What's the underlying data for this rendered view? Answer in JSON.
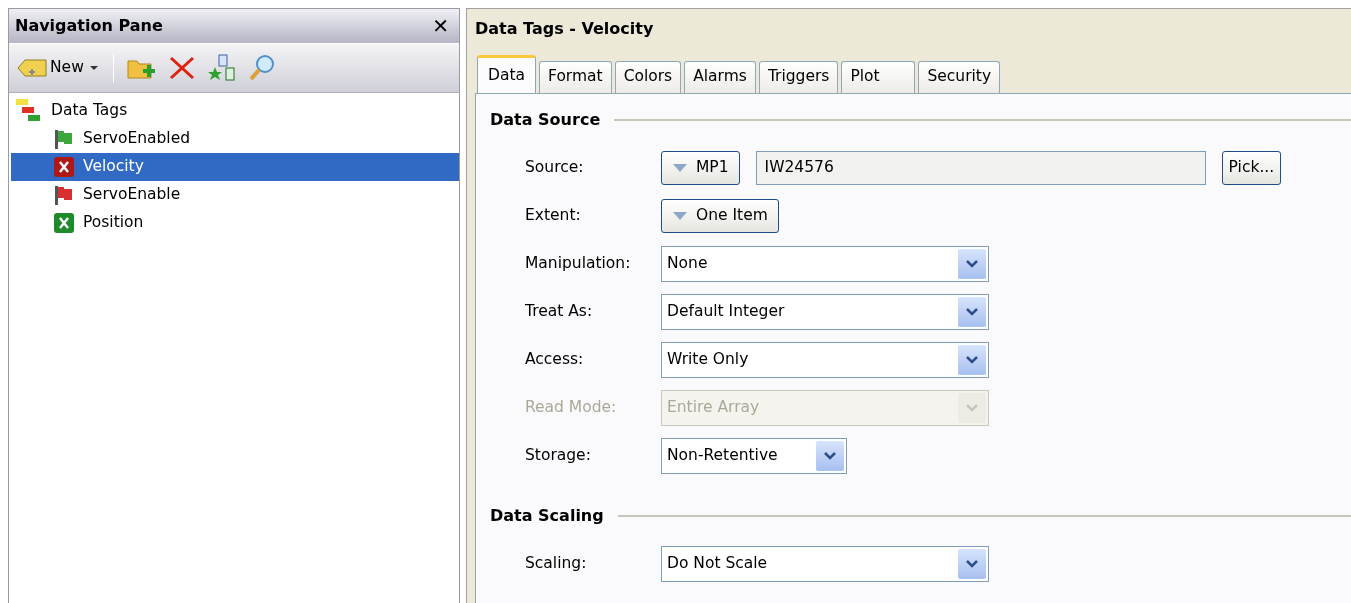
{
  "navigation_pane": {
    "title": "Navigation Pane",
    "close": "✕",
    "toolbar": {
      "new_button": "New"
    },
    "tree": [
      {
        "label": "Data Tags",
        "selected": false,
        "children": [
          {
            "label": "ServoEnabled",
            "kind": "flag",
            "color": "#3ca83c",
            "selected": false
          },
          {
            "label": "Velocity",
            "kind": "x",
            "color": "#b01818",
            "selected": true
          },
          {
            "label": "ServoEnable",
            "kind": "flag",
            "color": "#d83030",
            "selected": false
          },
          {
            "label": "Position",
            "kind": "x",
            "color": "#1e8a2a",
            "selected": false
          }
        ]
      }
    ]
  },
  "editor": {
    "title": "Data Tags - Velocity",
    "tabs": [
      {
        "label": "Data",
        "selected": true
      },
      {
        "label": "Format",
        "selected": false
      },
      {
        "label": "Colors",
        "selected": false
      },
      {
        "label": "Alarms",
        "selected": false
      },
      {
        "label": "Triggers",
        "selected": false
      },
      {
        "label": "Plot",
        "selected": false
      },
      {
        "label": "Security",
        "selected": false
      }
    ],
    "sections": [
      {
        "title": "Data Source",
        "rows": [
          {
            "label": "Source:",
            "kind": "source",
            "button": "MP1",
            "value": "IW24576",
            "pick": "Pick..."
          },
          {
            "label": "Extent:",
            "kind": "button",
            "button": "One Item"
          },
          {
            "label": "Manipulation:",
            "kind": "select",
            "value": "None",
            "disabled": false
          },
          {
            "label": "Treat As:",
            "kind": "select",
            "value": "Default Integer",
            "disabled": false
          },
          {
            "label": "Access:",
            "kind": "select",
            "value": "Write Only",
            "disabled": false
          },
          {
            "label": "Read Mode:",
            "kind": "select",
            "value": "Entire Array",
            "disabled": true
          },
          {
            "label": "Storage:",
            "kind": "short-select",
            "value": "Non-Retentive",
            "disabled": false
          }
        ]
      },
      {
        "title": "Data Scaling",
        "rows": [
          {
            "label": "Scaling:",
            "kind": "select",
            "value": "Do Not Scale",
            "disabled": false
          }
        ]
      }
    ]
  }
}
